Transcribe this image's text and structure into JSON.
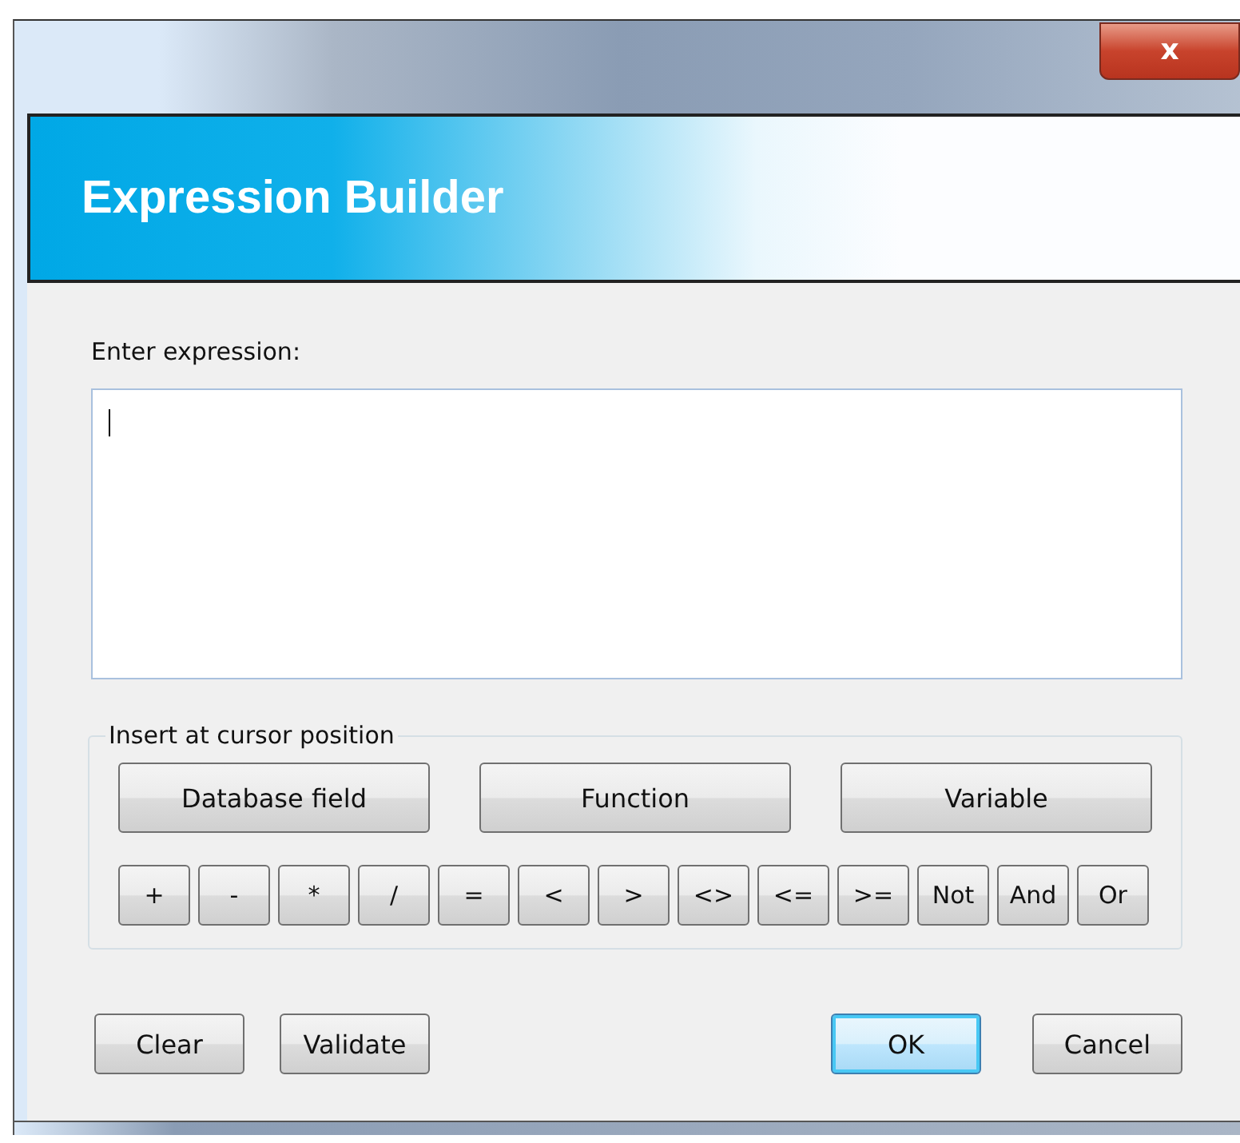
{
  "window": {
    "close_label": "x"
  },
  "header": {
    "title": "Expression Builder"
  },
  "expression": {
    "label": "Enter expression:"
  },
  "insert_group": {
    "legend": "Insert at cursor position",
    "large_buttons": [
      "Database field",
      "Function",
      "Variable"
    ],
    "operator_buttons": [
      "+",
      "-",
      "*",
      "/",
      "=",
      "<",
      ">",
      "<>",
      "<=",
      ">=",
      "Not",
      "And",
      "Or"
    ]
  },
  "footer_left": [
    {
      "label": "Clear",
      "default": false
    },
    {
      "label": "Validate",
      "default": false
    }
  ],
  "footer_right": [
    {
      "label": "OK",
      "default": true
    },
    {
      "label": "Cancel",
      "default": false
    }
  ]
}
